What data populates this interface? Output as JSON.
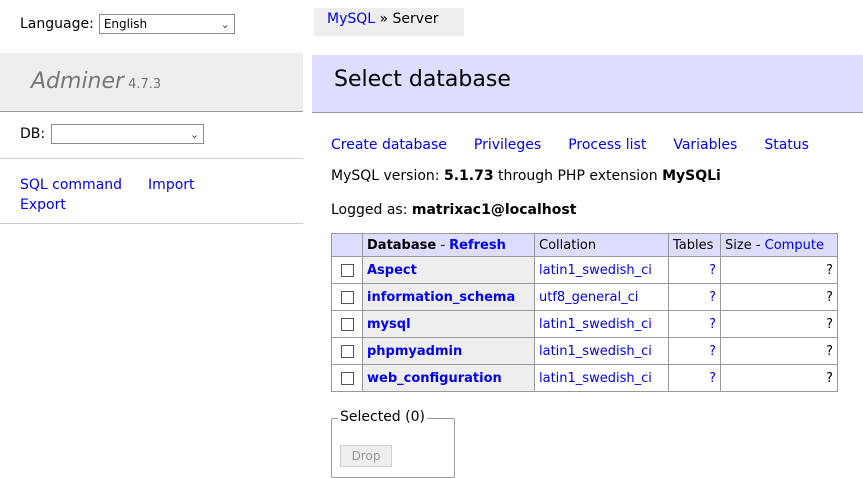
{
  "sidebar": {
    "language_label": "Language:",
    "language_value": "English",
    "app_name": "Adminer",
    "app_version": "4.7.3",
    "db_label": "DB:",
    "db_value": "",
    "links": {
      "sql_command": "SQL command",
      "import": "Import",
      "export": "Export"
    }
  },
  "breadcrumb": {
    "driver": "MySQL",
    "sep": " » ",
    "current": "Server"
  },
  "main": {
    "title": "Select database",
    "links": [
      "Create database",
      "Privileges",
      "Process list",
      "Variables",
      "Status"
    ],
    "version_prefix": "MySQL version: ",
    "version": "5.1.73",
    "version_middle": " through PHP extension ",
    "extension": "MySQLi",
    "logged_prefix": "Logged as: ",
    "logged_user": "matrixac1@localhost"
  },
  "table": {
    "headers": {
      "database": "Database",
      "dash1": " - ",
      "refresh": "Refresh",
      "collation": "Collation",
      "tables": "Tables",
      "size": "Size",
      "dash2": " - ",
      "compute": "Compute"
    },
    "rows": [
      {
        "name": "Aspect",
        "collation": "latin1_swedish_ci",
        "tables": "?",
        "size": "?"
      },
      {
        "name": "information_schema",
        "collation": "utf8_general_ci",
        "tables": "?",
        "size": "?"
      },
      {
        "name": "mysql",
        "collation": "latin1_swedish_ci",
        "tables": "?",
        "size": "?"
      },
      {
        "name": "phpmyadmin",
        "collation": "latin1_swedish_ci",
        "tables": "?",
        "size": "?"
      },
      {
        "name": "web_configuration",
        "collation": "latin1_swedish_ci",
        "tables": "?",
        "size": "?"
      }
    ]
  },
  "selected": {
    "legend": "Selected (0)",
    "drop_label": "Drop"
  },
  "icons": {
    "dropdown": "chevron-down-icon",
    "checkbox": "checkbox-icon"
  },
  "colors": {
    "link": "#0000ee",
    "title_bar": "#ddddff",
    "sidebar_bar": "#eeeeee"
  }
}
